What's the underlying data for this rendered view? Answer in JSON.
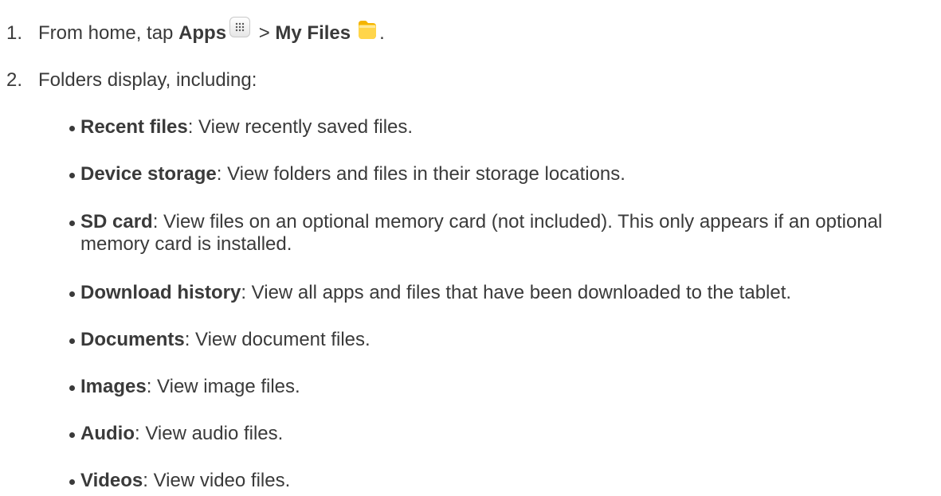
{
  "steps": [
    {
      "number": "1.",
      "text_before": "From home, tap ",
      "apps_label": "Apps",
      "separator": " > ",
      "myfiles_label": "My Files",
      "end": ".",
      "icons": [
        "apps-grid-icon",
        "folder-icon"
      ]
    },
    {
      "number": "2.",
      "text": "Folders display, including:"
    }
  ],
  "bullets": [
    {
      "term": "Recent files",
      "desc": ": View recently saved files."
    },
    {
      "term": "Device storage",
      "desc": ": View folders and files in their storage locations."
    },
    {
      "term": "SD card",
      "desc": ": View files on an optional memory card (not included). This only appears if an optional memory card is installed."
    },
    {
      "term": "Download history",
      "desc": ": View all apps and files that have been downloaded to the tablet."
    },
    {
      "term": "Documents",
      "desc": ": View document files."
    },
    {
      "term": "Images",
      "desc": ": View image files."
    },
    {
      "term": "Audio",
      "desc": ": View audio files."
    },
    {
      "term": "Videos",
      "desc": ": View video files."
    }
  ],
  "colors": {
    "text": "#3a3a3a",
    "folder_yellow": "#f7c21b"
  }
}
